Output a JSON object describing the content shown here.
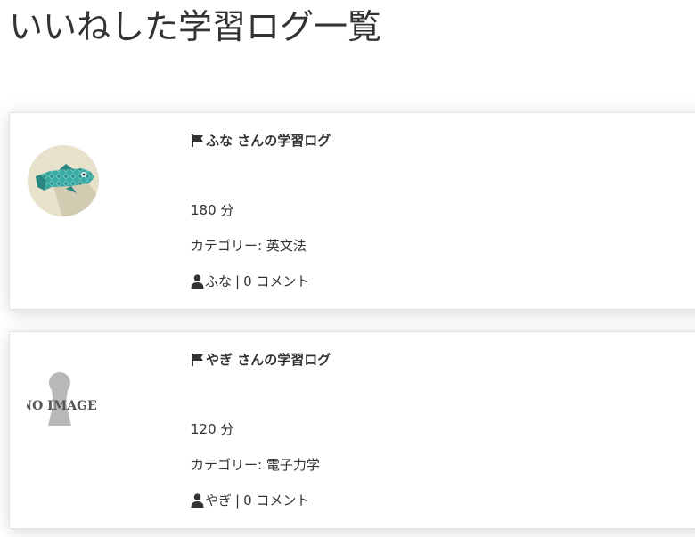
{
  "page": {
    "title": "いいねした学習ログ一覧"
  },
  "logs": [
    {
      "title": "ふな さんの学習ログ",
      "minutes": "180 分",
      "category": "カテゴリー: 英文法",
      "user": "ふな",
      "separator": "|",
      "comments": "0 コメント",
      "avatar": "fish-avatar-icon"
    },
    {
      "title": "やぎ さんの学習ログ",
      "minutes": "120 分",
      "category": "カテゴリー: 電子力学",
      "user": "やぎ",
      "separator": "|",
      "comments": "0 コメント",
      "avatar": "no-image-placeholder",
      "avatar_text": "NO IMAGE"
    }
  ],
  "colors": {
    "text": "#333333",
    "card_border": "#e2e2e2",
    "avatar_bg": "#e8e1cc",
    "fish_teal": "#3aa7a0"
  }
}
